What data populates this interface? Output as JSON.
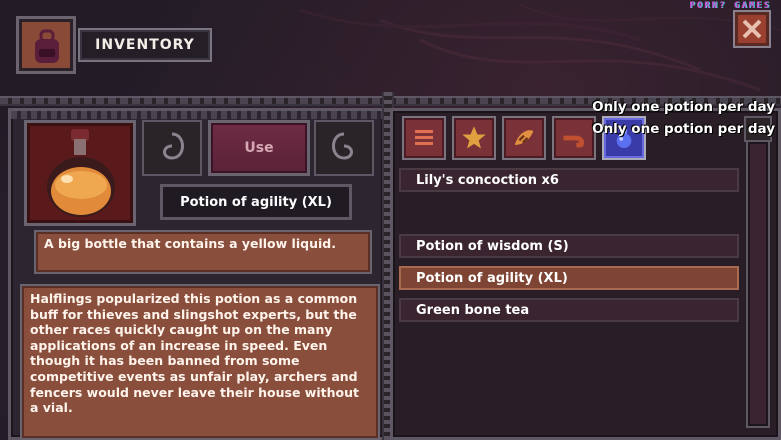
{
  "header": {
    "title": "INVENTORY",
    "watermark": "PORN? GAMES"
  },
  "tooltips": [
    "Only one potion per day",
    "Only one potion per day"
  ],
  "detail": {
    "use_label": "Use",
    "item_name": "Potion of agility (XL)",
    "short_description": "A big bottle that contains a yellow liquid.",
    "long_description": "Halflings popularized this potion as a common buff for thieves and slingshot experts, but the other races quickly caught up on the many applications of an increase in speed. Even though it has been banned from some competitive events as unfair play, archers and fencers would never leave their house without a vial."
  },
  "tabs": [
    {
      "icon": "list-icon",
      "selected": false
    },
    {
      "icon": "star-icon",
      "selected": false
    },
    {
      "icon": "claw-icon",
      "selected": false
    },
    {
      "icon": "pipe-icon",
      "selected": false
    },
    {
      "icon": "potion-icon",
      "selected": true
    }
  ],
  "items": [
    {
      "label": "Lily's concoction x6",
      "selected": false
    },
    {
      "label": "Potion of wisdom (S)",
      "selected": false
    },
    {
      "label": "Potion of agility (XL)",
      "selected": true
    },
    {
      "label": "Green bone tea",
      "selected": false
    }
  ],
  "colors": {
    "panel_fill": "#8a4e3c",
    "selected_row": "#7e4434",
    "use_button": "#6e2c44",
    "selected_tab": "#3a3aa8"
  }
}
